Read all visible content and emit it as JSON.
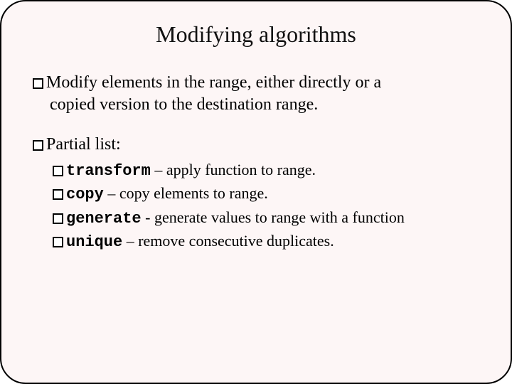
{
  "title": "Modifying algorithms",
  "p1_a": "Modify elements in the range, either directly or a",
  "p1_b": "copied version to the destination range.",
  "p2": "Partial list:",
  "items": [
    {
      "name": "transform",
      "sep": " – ",
      "desc": "apply function to range."
    },
    {
      "name": "copy",
      "sep": " – ",
      "desc": "copy elements to range."
    },
    {
      "name": "generate",
      "sep": " - ",
      "desc": "generate values to range with a function"
    },
    {
      "name": "unique",
      "sep": " – ",
      "desc": "remove consecutive duplicates."
    }
  ]
}
